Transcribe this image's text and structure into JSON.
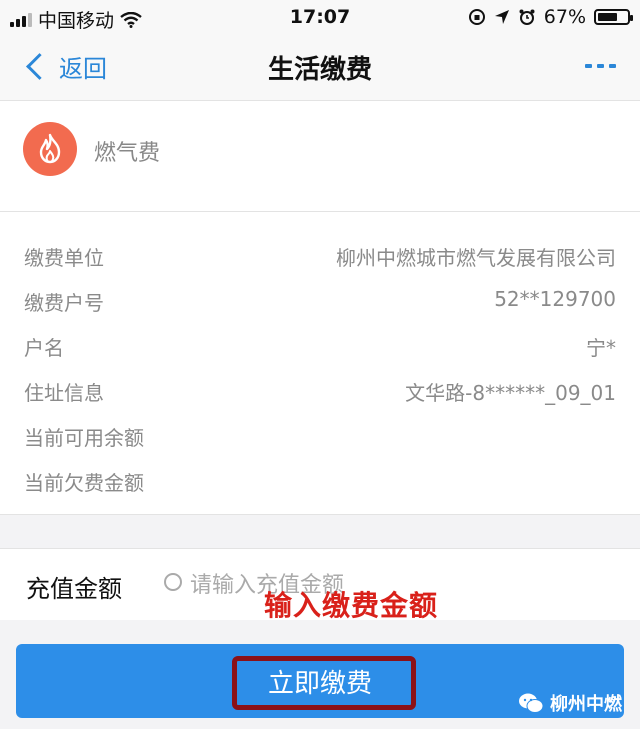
{
  "status_bar": {
    "carrier": "中国移动",
    "time": "17:07",
    "battery_percent": "67%",
    "battery_level": 0.67
  },
  "nav": {
    "back_label": "返回",
    "title": "生活缴费"
  },
  "biller": {
    "name": "燃气费",
    "icon": "flame-icon",
    "icon_color": "#f26b4f"
  },
  "details": [
    {
      "label": "缴费单位",
      "value": "柳州中燃城市燃气发展有限公司"
    },
    {
      "label": "缴费户号",
      "value": "52**129700"
    },
    {
      "label": "户名",
      "value": "宁*"
    },
    {
      "label": "住址信息",
      "value": "文华路-8******_09_01"
    },
    {
      "label": "当前可用余额",
      "value": ""
    },
    {
      "label": "当前欠费金额",
      "value": ""
    }
  ],
  "amount": {
    "label": "充值金额",
    "placeholder": "请输入充值金额"
  },
  "annotation": "输入缴费金额",
  "pay_button_label": "立即缴费",
  "watermark": "柳州中燃",
  "colors": {
    "accent": "#2b87d8",
    "button": "#2d8ee8",
    "annotation_red": "#d9211a",
    "highlight_border": "#8b1118"
  }
}
